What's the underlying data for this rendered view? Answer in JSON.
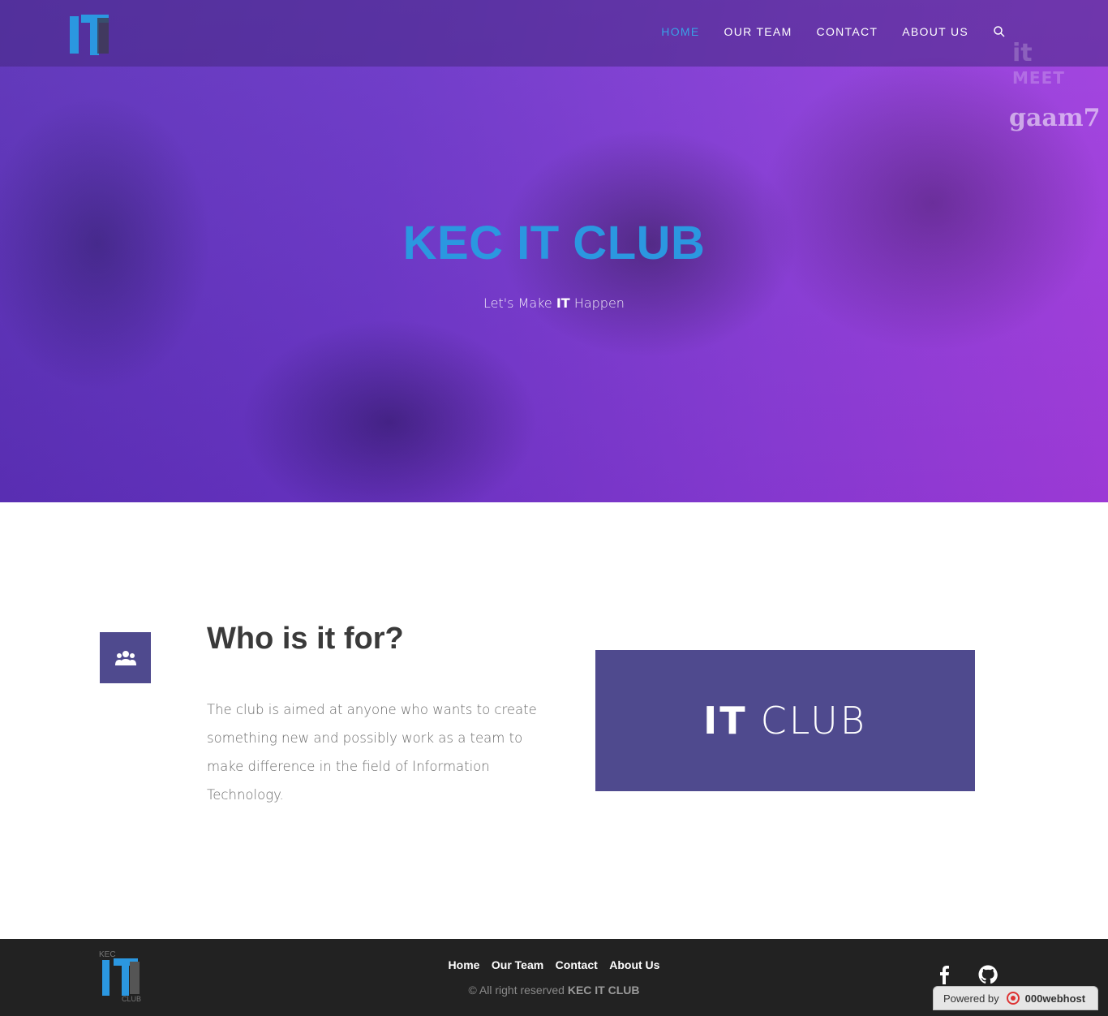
{
  "nav": {
    "logo_text": "IT",
    "items": [
      {
        "label": "HOME",
        "active": true
      },
      {
        "label": "OUR TEAM",
        "active": false
      },
      {
        "label": "CONTACT",
        "active": false
      },
      {
        "label": "ABOUT US",
        "active": false
      }
    ],
    "search_icon": "search-icon"
  },
  "hero": {
    "badge_it": "it",
    "badge_meet": "MEET",
    "badge_gaam": "gaam7",
    "title": "KEC IT CLUB",
    "subtitle_pre": "Let's Make",
    "subtitle_strong": "IT",
    "subtitle_post": "Happen"
  },
  "feature": {
    "icon": "users-icon",
    "title": "Who is it for?",
    "text": "The club is aimed at anyone who wants to create something new and possibly work as a team to make difference in the field of Information Technology.",
    "banner_bold": "IT",
    "banner_light": "CLUB"
  },
  "footer": {
    "logo_text": "KEC IT CLUB",
    "links": [
      "Home",
      "Our Team",
      "Contact",
      "About Us"
    ],
    "copyright_pre": "© All right reserved",
    "copyright_strong": "KEC IT CLUB",
    "social": [
      "facebook-icon",
      "github-icon"
    ],
    "powered_label": "Powered by",
    "powered_host": "000webhost"
  },
  "colors": {
    "accent": "#3aa0e6",
    "hero_title": "#2b97e0",
    "brand_purple": "#4f4a8e",
    "footer_bg": "#222222"
  }
}
